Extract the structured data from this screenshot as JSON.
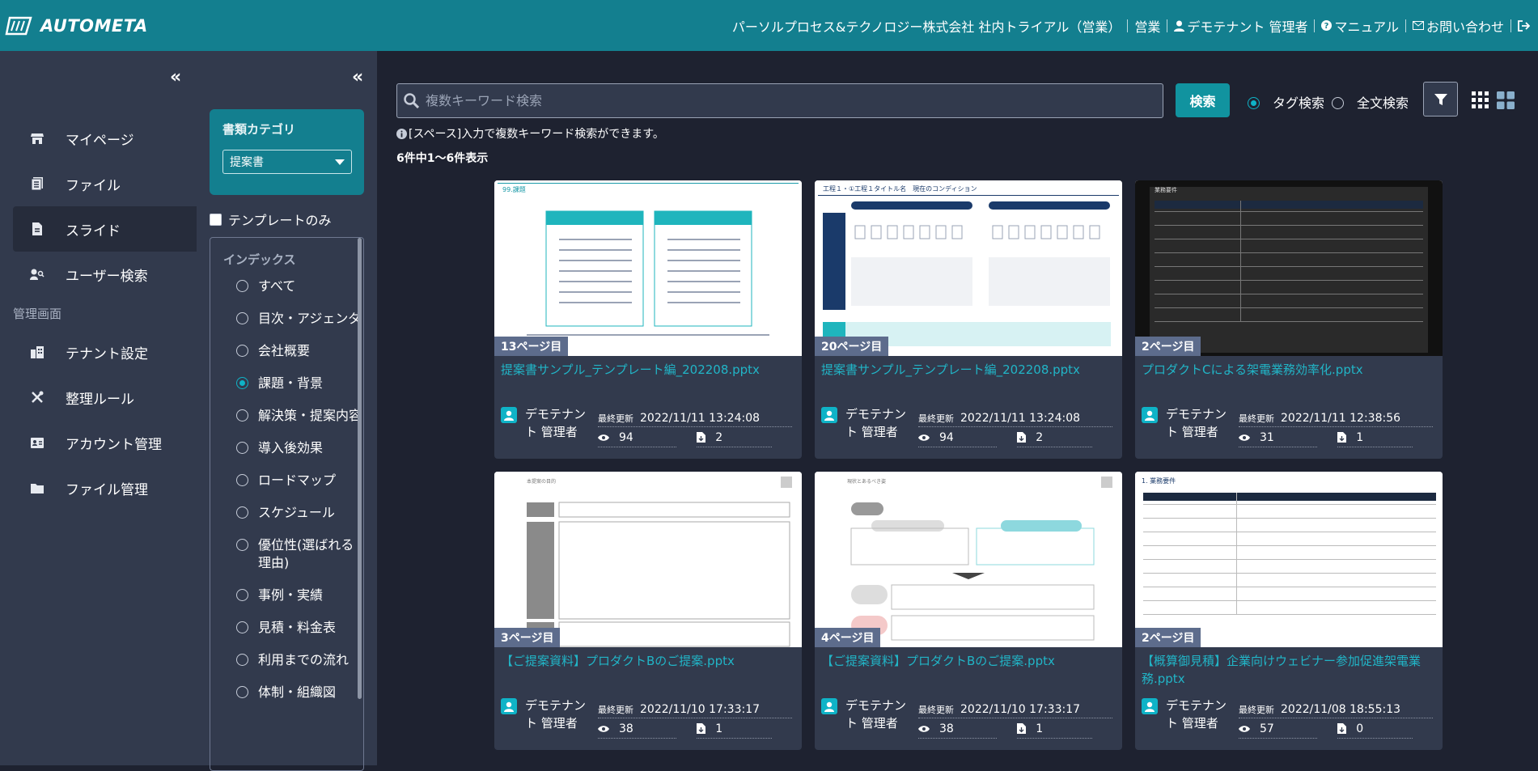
{
  "header": {
    "logo_text": "AUTOMETA",
    "company": "パーソルプロセス&テクノロジー株式会社 社内トライアル（営業）",
    "dept": "営業",
    "user": "デモテナント 管理者",
    "manual": "マニュアル",
    "contact": "お問い合わせ"
  },
  "sidebar": {
    "collapse": "«",
    "items": [
      {
        "label": "マイページ",
        "icon": "store-icon"
      },
      {
        "label": "ファイル",
        "icon": "file-list-icon"
      },
      {
        "label": "スライド",
        "icon": "document-icon"
      },
      {
        "label": "ユーザー検索",
        "icon": "user-search-icon"
      }
    ],
    "admin_heading": "管理画面",
    "admin_items": [
      {
        "label": "テナント設定",
        "icon": "building-icon"
      },
      {
        "label": "整理ルール",
        "icon": "tools-icon"
      },
      {
        "label": "アカウント管理",
        "icon": "id-card-icon"
      },
      {
        "label": "ファイル管理",
        "icon": "folder-icon"
      }
    ]
  },
  "filter": {
    "collapse": "«",
    "category_title": "書類カテゴリ",
    "category_value": "提案書",
    "template_only": "テンプレートのみ",
    "index_title": "インデックス",
    "index_items": [
      {
        "label": "すべて",
        "checked": false
      },
      {
        "label": "目次・アジェンダ",
        "checked": false
      },
      {
        "label": "会社概要",
        "checked": false
      },
      {
        "label": "課題・背景",
        "checked": true
      },
      {
        "label": "解決策・提案内容",
        "checked": false
      },
      {
        "label": "導入後効果",
        "checked": false
      },
      {
        "label": "ロードマップ",
        "checked": false
      },
      {
        "label": "スケジュール",
        "checked": false
      },
      {
        "label": "優位性(選ばれる理由)",
        "checked": false
      },
      {
        "label": "事例・実績",
        "checked": false
      },
      {
        "label": "見積・料金表",
        "checked": false
      },
      {
        "label": "利用までの流れ",
        "checked": false
      },
      {
        "label": "体制・組織図",
        "checked": false
      }
    ]
  },
  "search": {
    "placeholder": "複数キーワード検索",
    "button": "検索",
    "tag_search": "タグ検索",
    "fulltext_search": "全文検索",
    "hint": "[スペース]入力で複数キーワード検索ができます。",
    "count": "6件中1～6件表示"
  },
  "cards": [
    {
      "page": "13ページ目",
      "title": "提案書サンプル_テンプレート編_202208.pptx",
      "author": "デモテナント 管理者",
      "updated_label": "最終更新",
      "updated": "2022/11/11 13:24:08",
      "views": "94",
      "downloads": "2",
      "thumb": "A"
    },
    {
      "page": "20ページ目",
      "title": "提案書サンプル_テンプレート編_202208.pptx",
      "author": "デモテナント 管理者",
      "updated_label": "最終更新",
      "updated": "2022/11/11 13:24:08",
      "views": "94",
      "downloads": "2",
      "thumb": "B"
    },
    {
      "page": "2ページ目",
      "title": "プロダクトCによる架電業務効率化.pptx",
      "author": "デモテナント 管理者",
      "updated_label": "最終更新",
      "updated": "2022/11/11 12:38:56",
      "views": "31",
      "downloads": "1",
      "thumb": "C"
    },
    {
      "page": "3ページ目",
      "title": "【ご提案資料】プロダクトBのご提案.pptx",
      "author": "デモテナント 管理者",
      "updated_label": "最終更新",
      "updated": "2022/11/10 17:33:17",
      "views": "38",
      "downloads": "1",
      "thumb": "D"
    },
    {
      "page": "4ページ目",
      "title": "【ご提案資料】プロダクトBのご提案.pptx",
      "author": "デモテナント 管理者",
      "updated_label": "最終更新",
      "updated": "2022/11/10 17:33:17",
      "views": "38",
      "downloads": "1",
      "thumb": "E"
    },
    {
      "page": "2ページ目",
      "title": "【概算御見積】企業向けウェビナー参加促進架電業務.pptx",
      "author": "デモテナント 管理者",
      "updated_label": "最終更新",
      "updated": "2022/11/08 18:55:13",
      "views": "57",
      "downloads": "0",
      "thumb": "F"
    }
  ],
  "colors": {
    "brand": "#137f8f",
    "accent": "#0fb3c7",
    "link": "#21b5c7",
    "bg": "#1e2230",
    "panel": "#323a4d"
  }
}
